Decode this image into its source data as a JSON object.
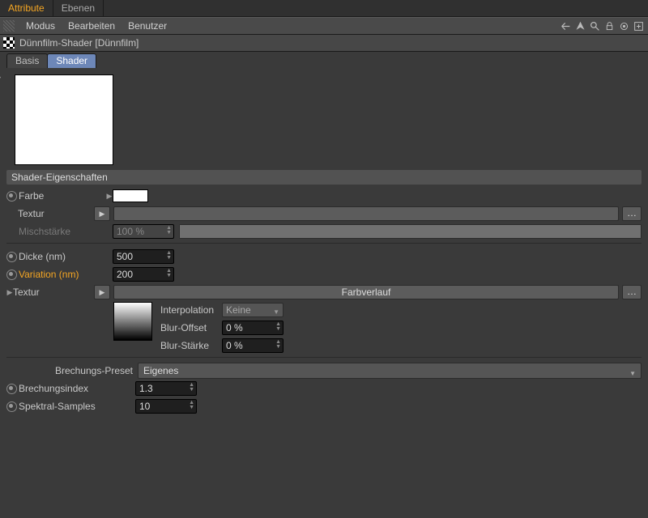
{
  "top_tabs": {
    "attribute": "Attribute",
    "ebenen": "Ebenen"
  },
  "menus": {
    "modus": "Modus",
    "bearbeiten": "Bearbeiten",
    "benutzer": "Benutzer"
  },
  "object_title": "Dünnfilm-Shader [Dünnfilm]",
  "sub_tabs": {
    "basis": "Basis",
    "shader": "Shader"
  },
  "section_header": "Shader-Eigenschaften",
  "props": {
    "farbe": {
      "label": "Farbe"
    },
    "textur1": {
      "label": "Textur"
    },
    "mischstaerke": {
      "label": "Mischstärke",
      "value": "100 %"
    },
    "dicke": {
      "label": "Dicke (nm)",
      "value": "500"
    },
    "variation": {
      "label": "Variation (nm)",
      "value": "200"
    },
    "textur2": {
      "label": "Textur",
      "value": "Farbverlauf"
    },
    "interpolation": {
      "label": "Interpolation",
      "value": "Keine"
    },
    "blur_offset": {
      "label": "Blur-Offset",
      "value": "0 %"
    },
    "blur_staerke": {
      "label": "Blur-Stärke",
      "value": "0 %"
    },
    "brechungs_preset": {
      "label": "Brechungs-Preset",
      "value": "Eigenes"
    },
    "brechungsindex": {
      "label": "Brechungsindex",
      "value": "1.3"
    },
    "spektral_samples": {
      "label": "Spektral-Samples",
      "value": "10"
    }
  },
  "icons": {
    "back": "back",
    "up": "up",
    "search": "search",
    "lock": "lock",
    "target": "target",
    "new": "new"
  }
}
